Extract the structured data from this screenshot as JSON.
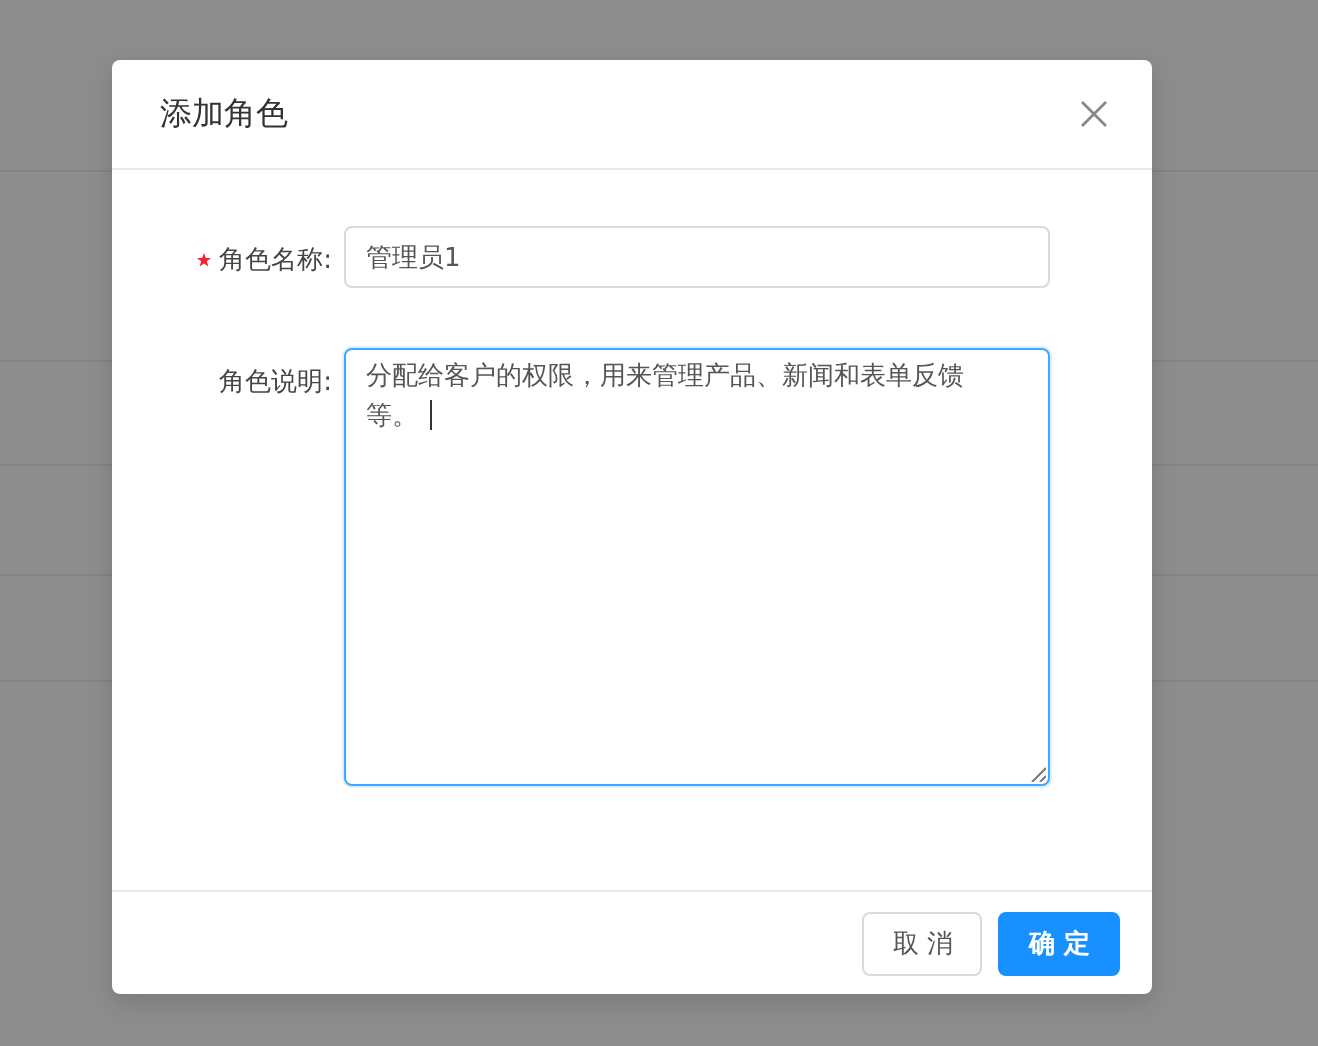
{
  "dialog": {
    "title": "添加角色",
    "fields": [
      {
        "kind": "input",
        "label": "角色名称:",
        "required": true,
        "value": "管理员1",
        "focused": false
      },
      {
        "kind": "textarea",
        "label": "角色说明:",
        "required": false,
        "value": "分配给客户的权限，用来管理产品、新闻和表单反馈等。",
        "focused": true
      }
    ],
    "buttons": [
      {
        "kind": "default",
        "label": "取 消"
      },
      {
        "kind": "primary",
        "label": "确 定"
      }
    ]
  }
}
